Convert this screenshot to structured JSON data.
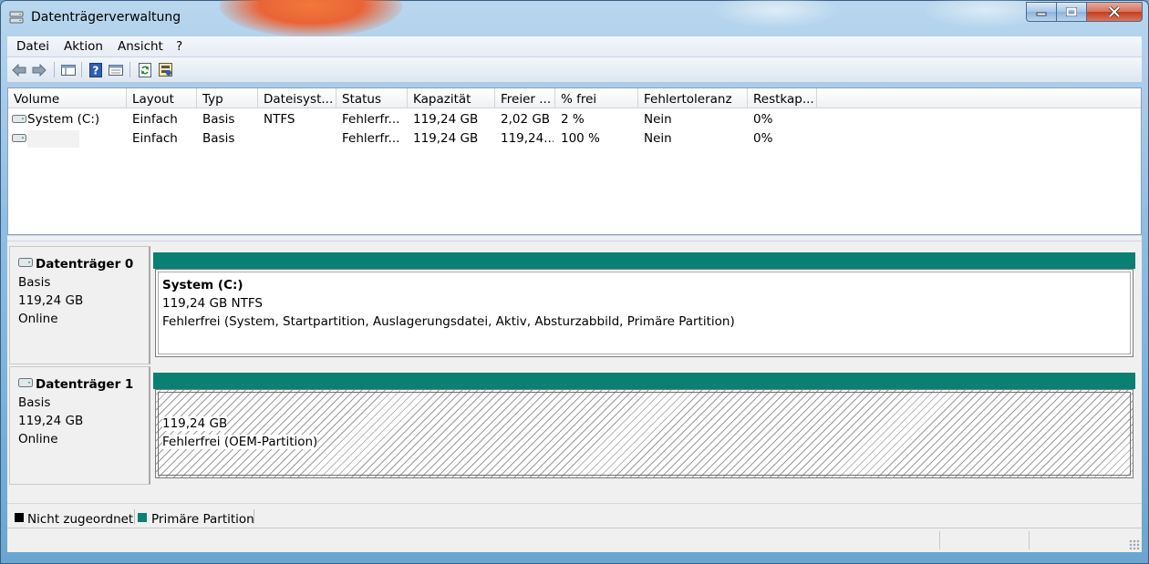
{
  "window": {
    "title": "Datenträgerverwaltung",
    "minimize_icon": "minimize-icon",
    "maximize_icon": "maximize-icon",
    "close_icon": "close-icon"
  },
  "menu": [
    "Datei",
    "Aktion",
    "Ansicht",
    "?"
  ],
  "toolbar": {
    "icons": [
      "back-arrow-icon",
      "forward-arrow-icon",
      "console-tree-icon",
      "help-icon",
      "properties-icon",
      "refresh-icon",
      "rescan-disks-icon"
    ]
  },
  "volume_list": {
    "columns": [
      "Volume",
      "Layout",
      "Typ",
      "Dateisyst...",
      "Status",
      "Kapazität",
      "Freier ...",
      "% frei",
      "Fehlertoleranz",
      "Restkap..."
    ],
    "rows": [
      [
        "System (C:)",
        "Einfach",
        "Basis",
        "NTFS",
        "Fehlerfr...",
        "119,24 GB",
        "2,02 GB",
        "2 %",
        "Nein",
        "0%"
      ],
      [
        "",
        "Einfach",
        "Basis",
        "",
        "Fehlerfr...",
        "119,24 GB",
        "119,24...",
        "100 %",
        "Nein",
        "0%"
      ]
    ]
  },
  "disks": [
    {
      "name": "Datenträger 0",
      "type": "Basis",
      "size": "119,24 GB",
      "state": "Online",
      "partition": {
        "title": "System  (C:)",
        "size_fs": "119,24 GB NTFS",
        "status": "Fehlerfrei (System, Startpartition, Auslagerungsdatei, Aktiv, Absturzabbild, Primäre Partition)"
      }
    },
    {
      "name": "Datenträger 1",
      "type": "Basis",
      "size": "119,24 GB",
      "state": "Online",
      "partition": {
        "title": "",
        "size_fs": "119,24 GB",
        "status": "Fehlerfrei (OEM-Partition)"
      }
    }
  ],
  "legend": [
    {
      "label": "Nicht zugeordnet",
      "color": "#000000"
    },
    {
      "label": "Primäre Partition",
      "color": "#0a8073"
    }
  ],
  "colors": {
    "primary_partition": "#0a8073",
    "unallocated": "#000000"
  }
}
